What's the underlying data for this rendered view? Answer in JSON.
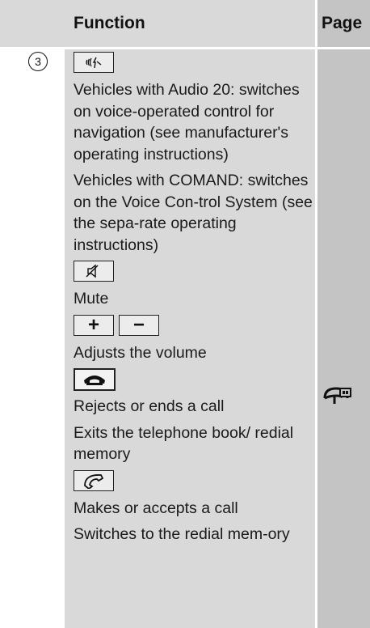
{
  "header": {
    "function_label": "Function",
    "page_label": "Page"
  },
  "row": {
    "number": "3",
    "paragraphs": {
      "p1": "Vehicles with Audio 20: switches on voice-operated control for navigation (see manufacturer's operating instructions)",
      "p2": "Vehicles with COMAND: switches on the Voice Con-trol System (see the sepa-rate operating instructions)",
      "p3": "Mute",
      "p4": "Adjusts the volume",
      "p5": "Rejects or ends a call",
      "p6": "Exits the telephone book/ redial memory",
      "p7": "Makes or accepts a call",
      "p8": "Switches to the redial mem-ory"
    },
    "keys": {
      "voice": "voice-control-icon",
      "mute": "mute-icon",
      "plus": "+",
      "minus": "−",
      "end_call": "end-call-icon",
      "accept_call": "accept-call-icon"
    },
    "page_ref_icon": "steering-wheel-display-icon"
  }
}
